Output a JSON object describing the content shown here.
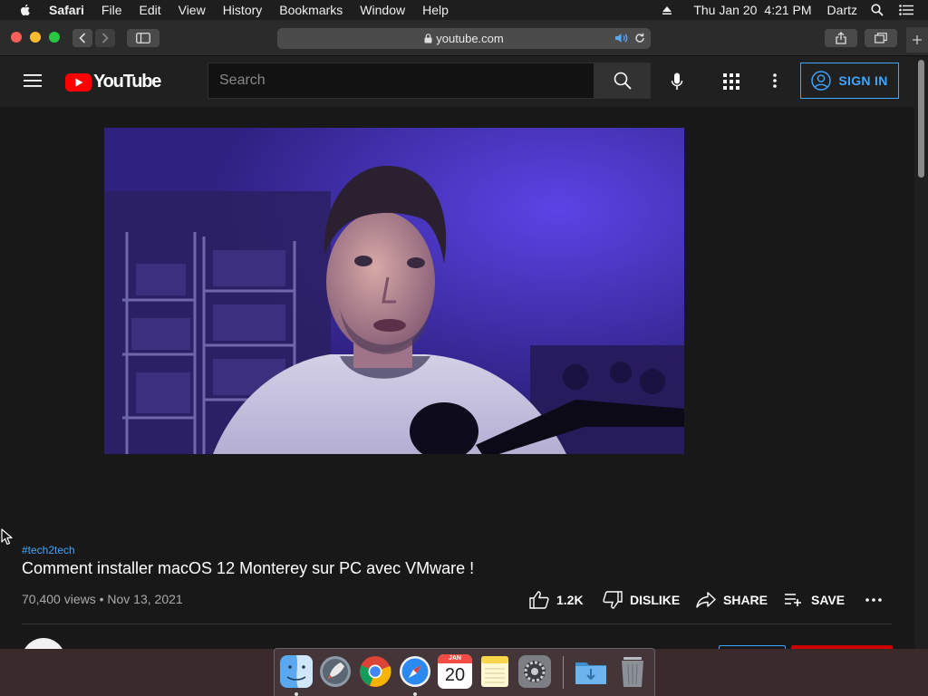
{
  "menubar": {
    "app": "Safari",
    "items": [
      "File",
      "Edit",
      "View",
      "History",
      "Bookmarks",
      "Window",
      "Help"
    ],
    "date": "Thu Jan 20",
    "time": "4:21 PM",
    "user": "Dartz"
  },
  "browser": {
    "url": "youtube.com"
  },
  "youtube": {
    "logo_text": "YouTube",
    "search_placeholder": "Search",
    "sign_in_label": "SIGN IN",
    "video": {
      "hashtag": "#tech2tech",
      "title": "Comment installer macOS 12 Monterey sur PC avec VMware !",
      "views": "70,400 views",
      "date": "Nov 13, 2021",
      "meta": "70,400 views • Nov 13, 2021",
      "likes": "1.2K",
      "dislike_label": "DISLIKE",
      "share_label": "SHARE",
      "save_label": "SAVE"
    }
  },
  "dock": {
    "calendar_month": "JAN",
    "calendar_day": "20",
    "apps": [
      "finder-icon",
      "launchpad-icon",
      "chrome-icon",
      "safari-icon",
      "calendar-icon",
      "notes-icon",
      "system-preferences-icon",
      "downloads-folder-icon",
      "trash-icon"
    ]
  },
  "colors": {
    "yt_red": "#ff0000",
    "link_blue": "#3ea6ff",
    "page_bg": "#181818",
    "header_bg": "#202020"
  }
}
